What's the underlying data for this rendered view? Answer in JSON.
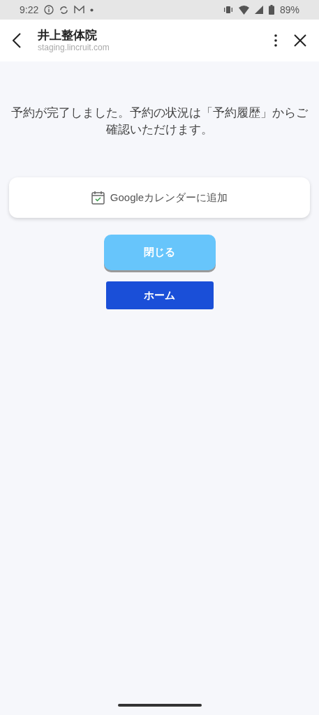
{
  "status_bar": {
    "time": "9:22",
    "battery": "89%"
  },
  "header": {
    "title": "井上整体院",
    "url": "staging.lincruit.com"
  },
  "message": "予約が完了しました。予約の状況は「予約履歴」からご確認いただけます。",
  "calendar_button": {
    "label": "Googleカレンダーに追加"
  },
  "buttons": [
    {
      "label": "閉じる",
      "kind": "light"
    },
    {
      "label": "ホーム",
      "kind": "primary"
    }
  ]
}
